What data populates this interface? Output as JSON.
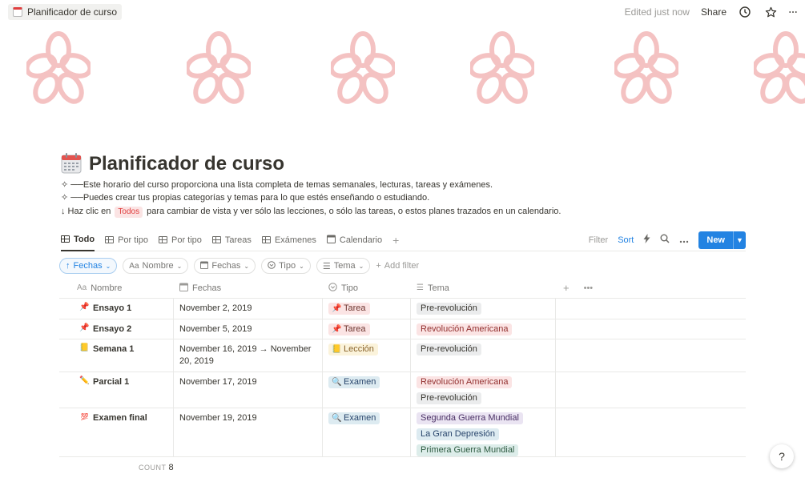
{
  "topbar": {
    "breadcrumb": "Planificador de curso",
    "edited": "Edited just now",
    "share": "Share"
  },
  "page": {
    "title": "Planificador de curso",
    "desc1": "✧ ──Este horario del curso proporciona una lista completa de temas semanales, lecturas, tareas y exámenes.",
    "desc2": "✧ ──Puedes crear tus propias categorías y temas para lo que estés enseñando o estudiando.",
    "desc3_pre": "↓ Haz clic en",
    "desc3_pill": "Todos",
    "desc3_post": "para cambiar de vista y ver sólo las lecciones, o sólo las tareas, o estos planes trazados en un calendario."
  },
  "views": {
    "tabs": [
      "Todo",
      "Por tipo",
      "Por tipo",
      "Tareas",
      "Exámenes",
      "Calendario"
    ],
    "filter": "Filter",
    "sort": "Sort",
    "new": "New"
  },
  "filters": {
    "fechas_sort": "Fechas",
    "nombre": "Nombre",
    "fechas": "Fechas",
    "tipo": "Tipo",
    "tema": "Tema",
    "add_filter": "Add filter"
  },
  "table": {
    "headers": [
      "Nombre",
      "Fechas",
      "Tipo",
      "Tema"
    ],
    "rows": [
      {
        "name": "Ensayo 1",
        "date": "November 2, 2019",
        "type": "Tarea",
        "themes": [
          "Pre-revolución"
        ]
      },
      {
        "name": "Ensayo 2",
        "date": "November 5, 2019",
        "type": "Tarea",
        "themes": [
          "Revolución Americana"
        ]
      },
      {
        "name": "Semana 1",
        "date": "November 16, 2019 → November 20, 2019",
        "type": "Lección",
        "themes": [
          "Pre-revolución"
        ]
      },
      {
        "name": "Parcial 1",
        "date": "November 17, 2019",
        "type": "Examen",
        "themes": [
          "Revolución Americana",
          "Pre-revolución"
        ]
      },
      {
        "name": "Examen final",
        "date": "November 19, 2019",
        "type": "Examen",
        "themes": [
          "Segunda Guerra Mundial",
          "La Gran Depresión",
          "Primera Guerra Mundial"
        ]
      }
    ],
    "count_label": "COUNT",
    "count_value": "8"
  },
  "help": "?"
}
